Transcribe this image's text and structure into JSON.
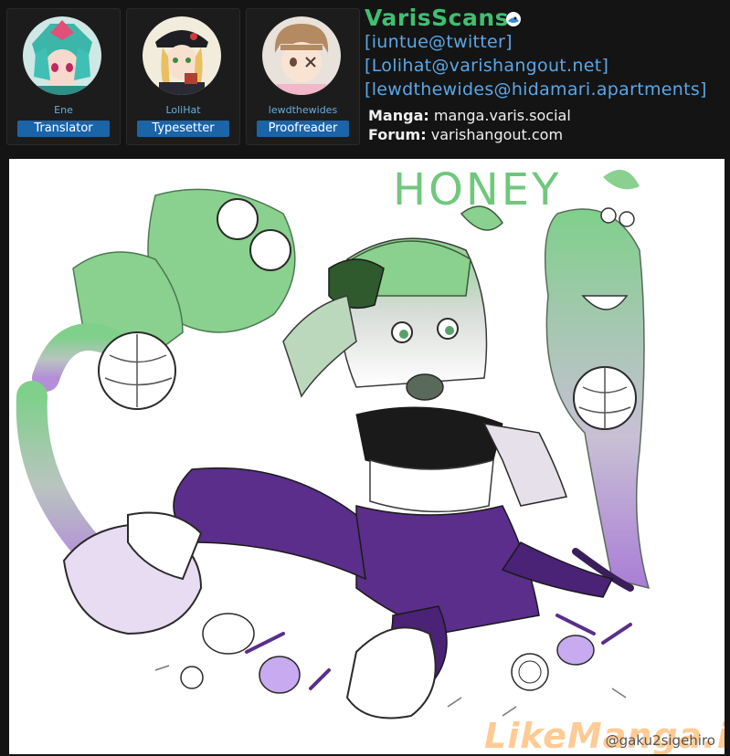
{
  "staff": [
    {
      "name": "Ene",
      "role": "Translator"
    },
    {
      "name": "LoliHat",
      "role": "Typesetter"
    },
    {
      "name": "lewdthewides",
      "role": "Proofreader"
    }
  ],
  "group": {
    "name": "VarisScans",
    "contacts": [
      "[iuntue@twitter]",
      "[Lolihat@varishangout.net]",
      "[lewdthewides@hidamari.apartments]"
    ],
    "manga_label": "Manga:",
    "manga_value": "manga.varis.social",
    "forum_label": "Forum:",
    "forum_value": "varishangout.com"
  },
  "artwork": {
    "title": "HONEY",
    "artist_credit": "@gaku2sigehiro",
    "watermark": "LikeManga.io"
  },
  "colors": {
    "accent_green": "#3ec070",
    "link_blue": "#5aa7e8",
    "role_badge": "#1c64a8",
    "art_green": "#6fc87c",
    "art_purple": "#5a2e8a"
  }
}
